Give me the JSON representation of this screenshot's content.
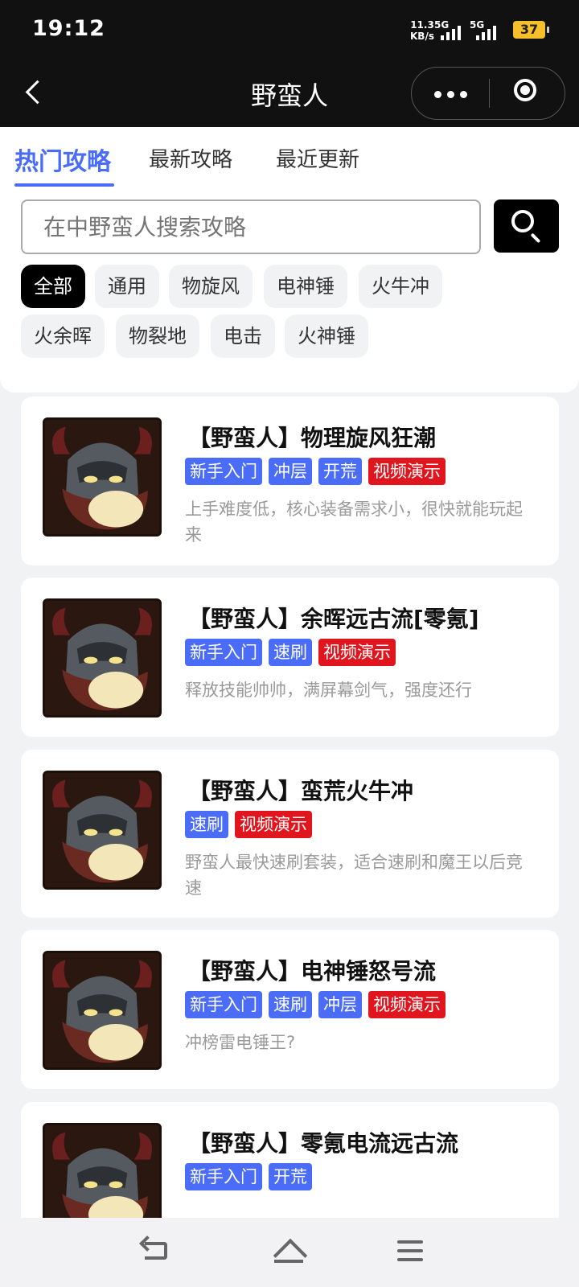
{
  "status_bar": {
    "time": "19:12",
    "net_speed_value": "11.3",
    "net_speed_unit": "KB/s",
    "signal1": "5G",
    "signal2": "5G",
    "battery": "37",
    "battery_color": "#f5c02c"
  },
  "nav": {
    "title": "野蛮人",
    "back_icon": "chevron-left-icon",
    "more_icon": "more-dots-icon",
    "close_icon": "target-circle-icon"
  },
  "tabs": [
    {
      "label": "热门攻略",
      "active": true
    },
    {
      "label": "最新攻略",
      "active": false
    },
    {
      "label": "最近更新",
      "active": false
    }
  ],
  "accent_color": "#4a6cf7",
  "search": {
    "placeholder": "在中野蛮人搜索攻略",
    "value": "",
    "icon": "search-icon"
  },
  "filters": [
    {
      "label": "全部",
      "active": true
    },
    {
      "label": "通用"
    },
    {
      "label": "物旋风"
    },
    {
      "label": "电神锤"
    },
    {
      "label": "火牛冲"
    },
    {
      "label": "火余晖"
    },
    {
      "label": "物裂地"
    },
    {
      "label": "电击"
    },
    {
      "label": "火神锤"
    }
  ],
  "cards": [
    {
      "title": "【野蛮人】物理旋风狂潮",
      "tags": [
        {
          "label": "新手入门",
          "color": "blue"
        },
        {
          "label": "冲层",
          "color": "blue"
        },
        {
          "label": "开荒",
          "color": "blue"
        },
        {
          "label": "视频演示",
          "color": "red"
        }
      ],
      "desc": "上手难度低，核心装备需求小，很快就能玩起来"
    },
    {
      "title": "【野蛮人】余晖远古流[零氪]",
      "tags": [
        {
          "label": "新手入门",
          "color": "blue"
        },
        {
          "label": "速刷",
          "color": "blue"
        },
        {
          "label": "视频演示",
          "color": "red"
        }
      ],
      "desc": "释放技能帅帅，满屏幕剑气，强度还行"
    },
    {
      "title": "【野蛮人】蛮荒火牛冲",
      "tags": [
        {
          "label": "速刷",
          "color": "blue"
        },
        {
          "label": "视频演示",
          "color": "red"
        }
      ],
      "desc": "野蛮人最快速刷套装，适合速刷和魔王以后竞速"
    },
    {
      "title": "【野蛮人】电神锤怒号流",
      "tags": [
        {
          "label": "新手入门",
          "color": "blue"
        },
        {
          "label": "速刷",
          "color": "blue"
        },
        {
          "label": "冲层",
          "color": "blue"
        },
        {
          "label": "视频演示",
          "color": "red"
        }
      ],
      "desc": "冲榜雷电锤王?"
    },
    {
      "title": "【野蛮人】零氪电流远古流",
      "tags": [
        {
          "label": "新手入门",
          "color": "blue"
        },
        {
          "label": "开荒",
          "color": "blue"
        }
      ],
      "desc": ""
    }
  ],
  "system_nav": [
    "back-icon",
    "home-icon",
    "menu-icon"
  ]
}
